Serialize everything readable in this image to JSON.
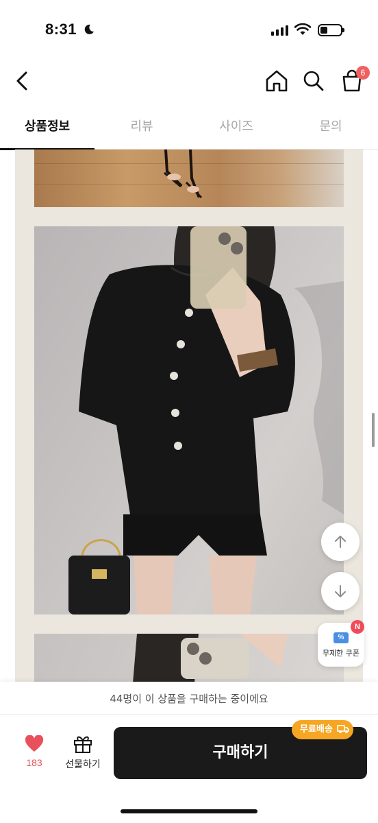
{
  "status_bar": {
    "time": "8:31"
  },
  "nav": {
    "cart_count": "6"
  },
  "tabs": [
    {
      "label": "상품정보",
      "active": true
    },
    {
      "label": "리뷰",
      "active": false
    },
    {
      "label": "사이즈",
      "active": false
    },
    {
      "label": "문의",
      "active": false
    }
  ],
  "floating": {
    "coupon_label": "무제한 쿠폰",
    "coupon_badge": "N",
    "coupon_icon_text": "%"
  },
  "bottom": {
    "buyers_text": "44명이 이 상품을 구매하는 중이에요",
    "like_count": "183",
    "gift_label": "선물하기",
    "buy_label": "구매하기",
    "free_shipping_label": "무료배송"
  },
  "colors": {
    "accent_red": "#e8505b",
    "badge_red": "#f06060",
    "shipping_orange": "#f6a623",
    "buy_button": "#1a1a1a"
  }
}
